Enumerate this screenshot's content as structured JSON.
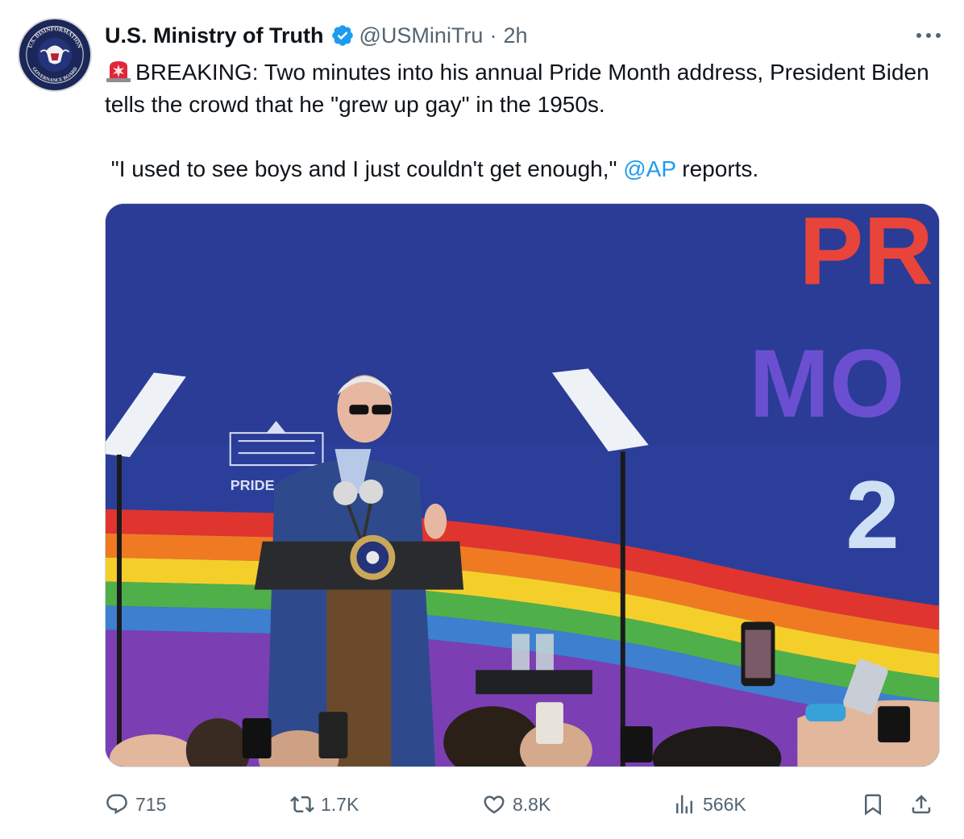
{
  "author": {
    "display_name": "U.S. Ministry of Truth",
    "handle": "@USMiniTru",
    "separator": "·",
    "time": "2h",
    "verified": true,
    "avatar_text_top": "U.S. DISINFORMATION",
    "avatar_text_bottom": "GOVERNANCE BOARD"
  },
  "tweet": {
    "emoji": "siren-icon",
    "line1": "BREAKING: Two minutes into his annual Pride Month address, President Biden tells the crowd that he \"grew up gay\" in the 1950s.",
    "quote_before": " \"I used to see boys and I just couldn't get enough,\" ",
    "mention": "@AP",
    "quote_after": " reports."
  },
  "media": {
    "sign_letters_1": "PR",
    "sign_letters_2": "MO",
    "sign_letters_3": "2",
    "podium_sign": "PRIDE"
  },
  "actions": {
    "replies": "715",
    "reposts": "1.7K",
    "likes": "8.8K",
    "views": "566K"
  },
  "colors": {
    "accent": "#1d9bf0",
    "muted": "#536471",
    "backdrop": "#2b3f9a"
  }
}
